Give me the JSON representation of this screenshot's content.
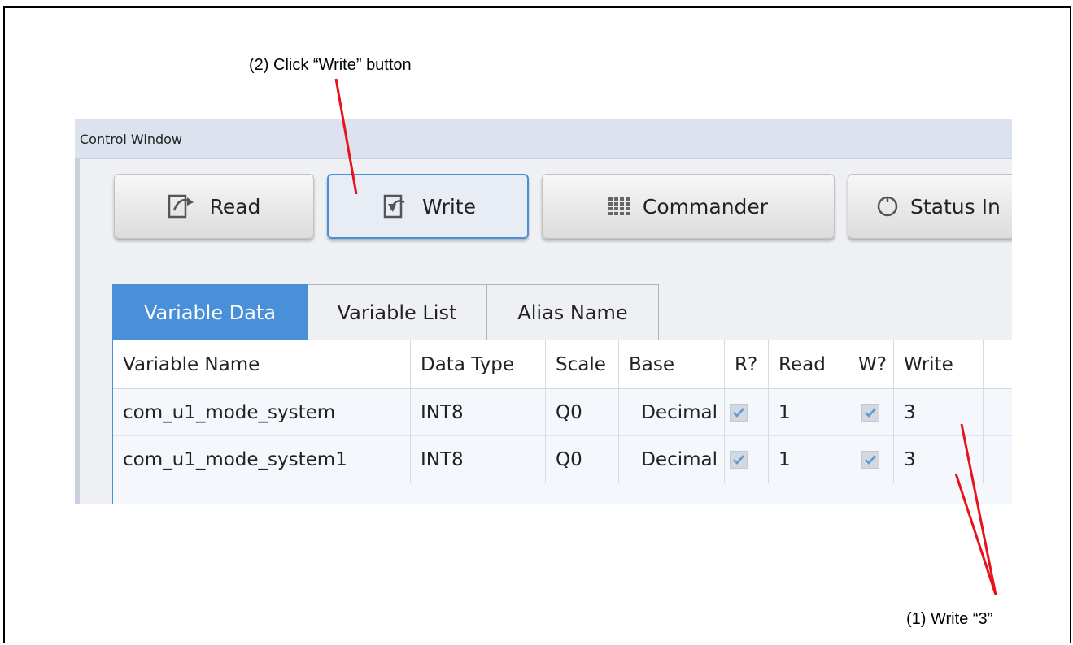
{
  "annotations": {
    "click_write": "(2) Click “Write” button",
    "write_value": "(1) Write “3”"
  },
  "window": {
    "title": "Control Window"
  },
  "toolbar": {
    "read_label": "Read",
    "write_label": "Write",
    "commander_label": "Commander",
    "status_label": "Status In"
  },
  "tabs": [
    {
      "label": "Variable Data",
      "selected": true
    },
    {
      "label": "Variable List",
      "selected": false
    },
    {
      "label": "Alias Name",
      "selected": false
    }
  ],
  "table": {
    "headers": {
      "variable_name": "Variable Name",
      "data_type": "Data Type",
      "scale": "Scale",
      "base": "Base",
      "r": "R?",
      "read": "Read",
      "w": "W?",
      "write": "Write"
    },
    "rows": [
      {
        "variable_name": "com_u1_mode_system",
        "data_type": "INT8",
        "scale": "Q0",
        "base": "Decimal",
        "r_checked": true,
        "read": "1",
        "w_checked": true,
        "write": "3"
      },
      {
        "variable_name": "com_u1_mode_system1",
        "data_type": "INT8",
        "scale": "Q0",
        "base": "Decimal",
        "r_checked": true,
        "read": "1",
        "w_checked": true,
        "write": "3"
      }
    ]
  },
  "colors": {
    "accent": "#4a90d9",
    "callout": "#e8121b",
    "checkmark": "#5b9bd5"
  }
}
